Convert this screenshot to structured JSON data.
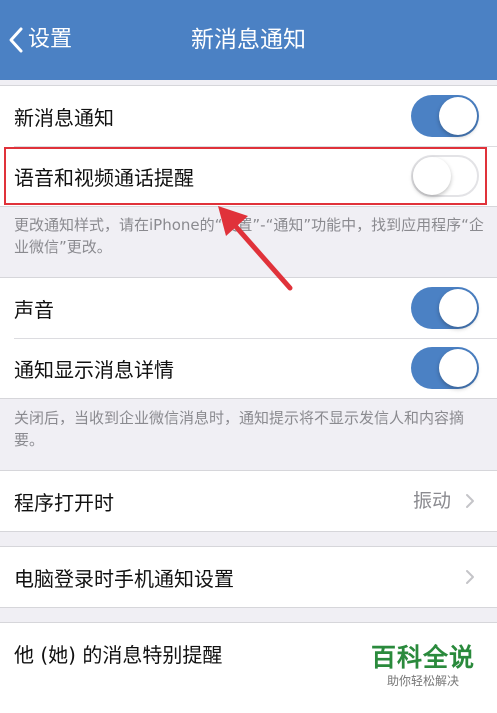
{
  "nav": {
    "back_label": "设置",
    "title": "新消息通知"
  },
  "section1": {
    "rows": [
      {
        "label": "新消息通知",
        "toggle": "on"
      },
      {
        "label": "语音和视频通话提醒",
        "toggle": "off"
      }
    ],
    "note": "更改通知样式，请在iPhone的“设置”-“通知”功能中，找到应用程序“企业微信”更改。"
  },
  "section2": {
    "rows": [
      {
        "label": "声音",
        "toggle": "on"
      },
      {
        "label": "通知显示消息详情",
        "toggle": "on"
      }
    ],
    "note": "关闭后，当收到企业微信消息时，通知提示将不显示发信人和内容摘要。"
  },
  "section3": {
    "label": "程序打开时",
    "value": "振动"
  },
  "section4": {
    "label": "电脑登录时手机通知设置"
  },
  "section5": {
    "label": "他 (她) 的消息特别提醒"
  },
  "watermark": {
    "title": "百科全说",
    "subtitle": "助你轻松解决"
  },
  "colors": {
    "navbar": "#4b81c4",
    "toggle_on": "#4b81c4",
    "highlight": "#e0323a",
    "watermark": "#2a8a3c"
  }
}
